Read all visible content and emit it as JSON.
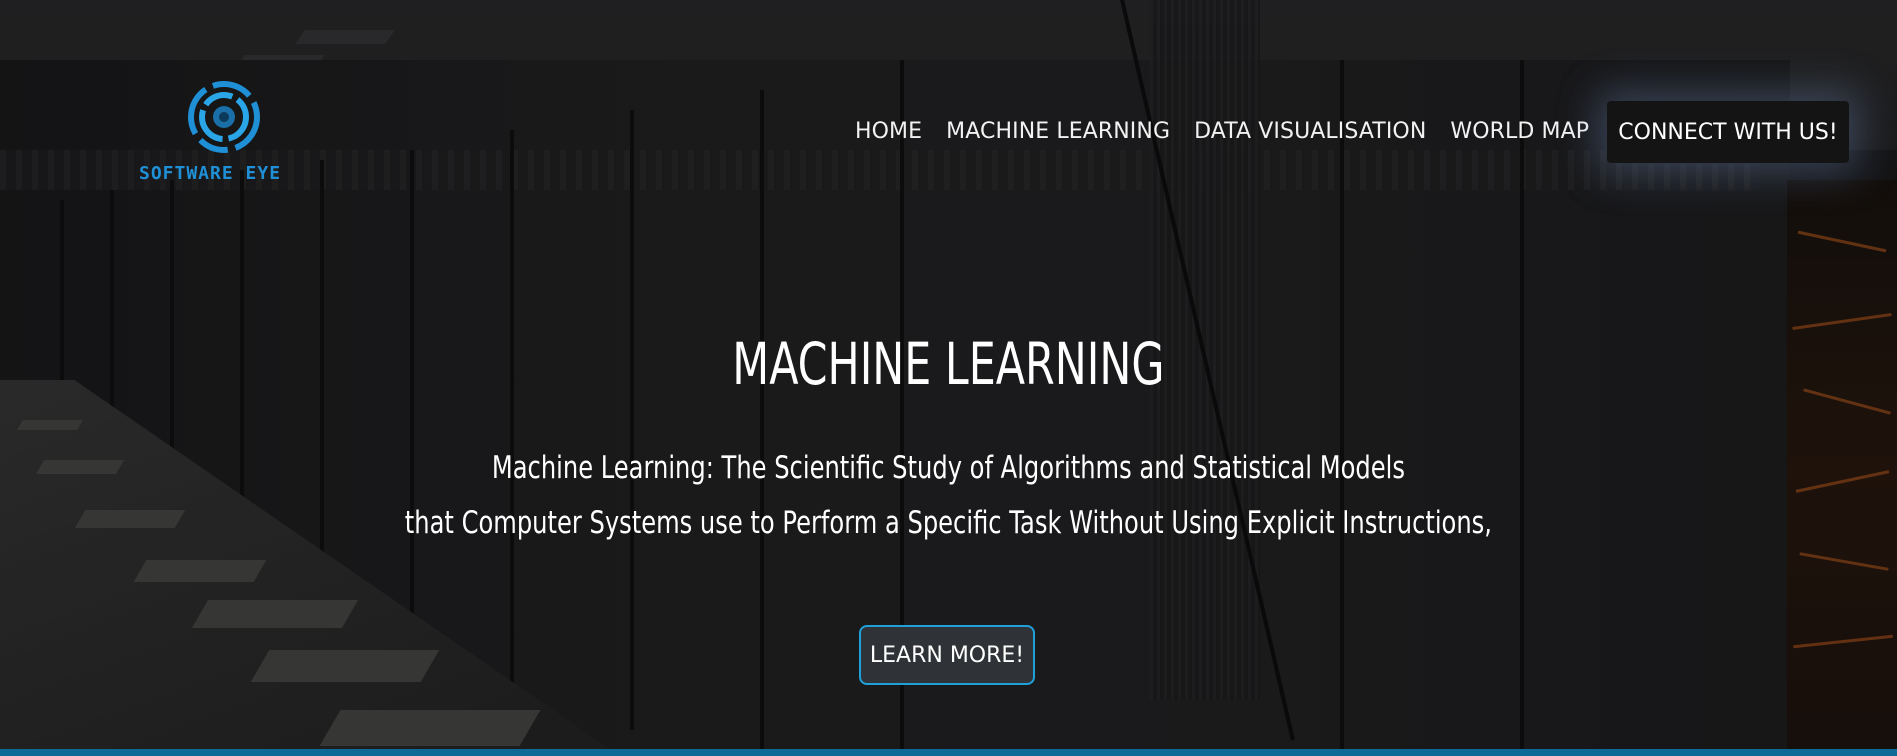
{
  "logo": {
    "text": "SOFTWARE EYE",
    "accent_color": "#1f8fd6",
    "icon": "eye-logo-icon"
  },
  "nav": {
    "items": [
      {
        "label": "HOME"
      },
      {
        "label": "MACHINE LEARNING"
      },
      {
        "label": "DATA VISUALISATION"
      },
      {
        "label": "WORLD MAP"
      }
    ],
    "cta_label": "CONNECT WITH US!"
  },
  "hero": {
    "title": "MACHINE LEARNING",
    "subtitle_line1": "Machine Learning: The Scientific Study of Algorithms and Statistical Models",
    "subtitle_line2": "that Computer Systems use to Perform a Specific Task Without Using Explicit Instructions,",
    "button_label": "LEARN MORE!",
    "button_border_color": "#1fa0d8"
  },
  "colors": {
    "bottom_bar": "#0e6a96"
  }
}
